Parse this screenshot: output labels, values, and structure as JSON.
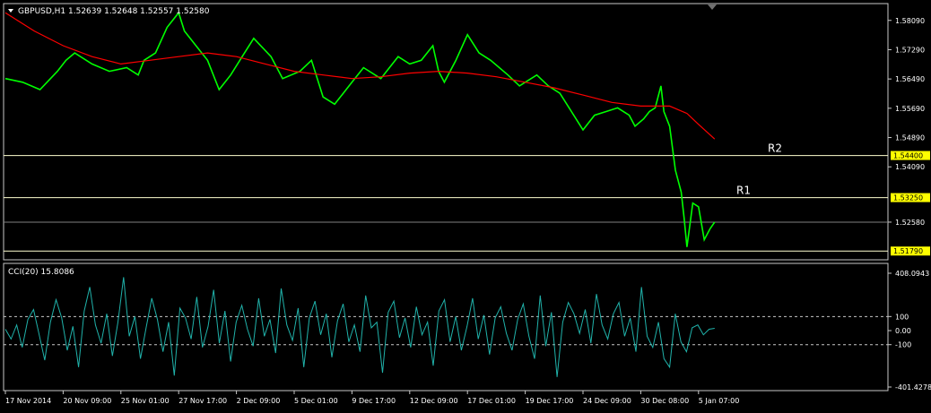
{
  "colors": {
    "background": "#000000",
    "frame": "#c8c8c8",
    "price": "#00ff00",
    "moving_average": "#ff0000",
    "levels": "#ffffd0",
    "level_label_bg": "#ffff00",
    "cci": "#20b2aa",
    "text": "#ffffff",
    "axis_text": "#ffffff"
  },
  "chart_data": [
    {
      "type": "line",
      "title": "GBPUSD,H1  1.52639 1.52648 1.52557 1.52580",
      "symbol": "GBPUSD",
      "timeframe": "H1",
      "ohlc_readout": {
        "open": 1.52639,
        "high": 1.52648,
        "low": 1.52557,
        "close": 1.5258
      },
      "ylim": [
        1.516,
        1.585
      ],
      "y_ticks": [
        "1.58090",
        "1.57290",
        "1.56490",
        "1.55690",
        "1.54890",
        "1.54090",
        "1.52580"
      ],
      "y_tick_values": [
        1.5809,
        1.5729,
        1.5649,
        1.5569,
        1.5489,
        1.5409,
        1.5258
      ],
      "current_price": 1.5258,
      "x_ticks": [
        "17 Nov 2014",
        "20 Nov 09:00",
        "25 Nov 01:00",
        "27 Nov 17:00",
        "2 Dec 09:00",
        "5 Dec 01:00",
        "9 Dec 17:00",
        "12 Dec 09:00",
        "17 Dec 01:00",
        "19 Dec 17:00",
        "24 Dec 09:00",
        "30 Dec 08:00",
        "5 Jan 07:00"
      ],
      "x_tick_index": [
        0,
        1,
        2,
        3,
        4,
        5,
        6,
        7,
        8,
        9,
        10,
        11,
        12
      ],
      "series": [
        {
          "style": "price",
          "x": [
            0,
            0.3,
            0.6,
            0.9,
            1.05,
            1.2,
            1.5,
            1.8,
            2.1,
            2.3,
            2.4,
            2.6,
            2.8,
            3.0,
            3.1,
            3.3,
            3.5,
            3.7,
            3.9,
            4.1,
            4.3,
            4.6,
            4.8,
            5.1,
            5.3,
            5.5,
            5.7,
            6.0,
            6.2,
            6.5,
            6.8,
            7.0,
            7.2,
            7.4,
            7.5,
            7.6,
            7.8,
            8.0,
            8.2,
            8.4,
            8.7,
            8.9,
            9.0,
            9.2,
            9.4,
            9.6,
            9.8,
            10.0,
            10.2,
            10.4,
            10.6,
            10.8,
            10.9,
            11.05,
            11.15,
            11.25,
            11.35,
            11.4,
            11.5,
            11.6,
            11.7,
            11.75,
            11.8,
            11.9,
            12.0,
            12.1,
            12.2,
            12.28
          ],
          "values": [
            1.565,
            1.564,
            1.562,
            1.567,
            1.57,
            1.572,
            1.569,
            1.567,
            1.568,
            1.566,
            1.57,
            1.572,
            1.579,
            1.583,
            1.578,
            1.574,
            1.57,
            1.562,
            1.566,
            1.571,
            1.576,
            1.571,
            1.565,
            1.567,
            1.57,
            1.56,
            1.558,
            1.564,
            1.568,
            1.565,
            1.571,
            1.569,
            1.57,
            1.574,
            1.567,
            1.564,
            1.57,
            1.577,
            1.572,
            1.57,
            1.566,
            1.563,
            1.564,
            1.566,
            1.563,
            1.561,
            1.556,
            1.551,
            1.555,
            1.556,
            1.557,
            1.555,
            1.552,
            1.554,
            1.556,
            1.557,
            1.563,
            1.556,
            1.552,
            1.54,
            1.534,
            1.527,
            1.519,
            1.531,
            1.53,
            1.521,
            1.524,
            1.5258
          ]
        },
        {
          "style": "moving_average",
          "x": [
            0,
            0.5,
            1.0,
            1.5,
            2.0,
            2.5,
            3.0,
            3.5,
            4.0,
            4.5,
            5.0,
            5.5,
            6.0,
            6.5,
            7.0,
            7.5,
            8.0,
            8.5,
            9.0,
            9.5,
            10.0,
            10.5,
            11.0,
            11.5,
            11.8,
            12.0,
            12.28
          ],
          "values": [
            1.583,
            1.578,
            1.574,
            1.571,
            1.569,
            1.57,
            1.571,
            1.572,
            1.571,
            1.569,
            1.567,
            1.566,
            1.565,
            1.5655,
            1.5665,
            1.567,
            1.5665,
            1.5655,
            1.564,
            1.5625,
            1.5605,
            1.5585,
            1.5575,
            1.5575,
            1.5555,
            1.5525,
            1.5485
          ]
        }
      ],
      "levels": [
        {
          "name": "R2",
          "value": 1.544,
          "label": "1.54400"
        },
        {
          "name": "R1",
          "value": 1.5325,
          "label": "1.53250"
        },
        {
          "name": "",
          "value": 1.5179,
          "label": "1.51790"
        }
      ]
    },
    {
      "type": "line",
      "title": "CCI(20) 15.8086",
      "indicator": "CCI(20)",
      "current_value": 15.8086,
      "ylim": [
        -401.4278,
        408.0943
      ],
      "y_ticks": [
        "408.0943",
        "100",
        "0.00",
        "-100",
        "-401.4278"
      ],
      "y_tick_values": [
        408.0943,
        100,
        0,
        -100,
        -401.4278
      ],
      "dashed_levels": [
        100,
        -100
      ],
      "values": [
        10,
        -60,
        40,
        -120,
        80,
        150,
        -30,
        -210,
        60,
        220,
        90,
        -140,
        30,
        -260,
        140,
        310,
        40,
        -90,
        120,
        -180,
        60,
        380,
        -40,
        100,
        -200,
        20,
        230,
        80,
        -150,
        60,
        -320,
        160,
        90,
        -60,
        240,
        -120,
        30,
        290,
        -90,
        140,
        -220,
        60,
        180,
        10,
        -110,
        230,
        -40,
        80,
        -160,
        300,
        40,
        -70,
        160,
        -260,
        90,
        210,
        -30,
        120,
        -190,
        70,
        190,
        -80,
        40,
        -150,
        250,
        20,
        60,
        -300,
        130,
        210,
        -50,
        90,
        -120,
        170,
        -30,
        60,
        -250,
        140,
        220,
        -80,
        100,
        -140,
        30,
        230,
        -60,
        110,
        -170,
        90,
        170,
        -20,
        -140,
        80,
        190,
        -40,
        -200,
        250,
        -110,
        130,
        -330,
        60,
        200,
        120,
        -20,
        150,
        -90,
        260,
        40,
        -60,
        120,
        200,
        -40,
        90,
        -150,
        310,
        -40,
        -120,
        60,
        -200,
        -260,
        120,
        -80,
        -150,
        20,
        40,
        -30,
        10,
        16
      ]
    }
  ]
}
